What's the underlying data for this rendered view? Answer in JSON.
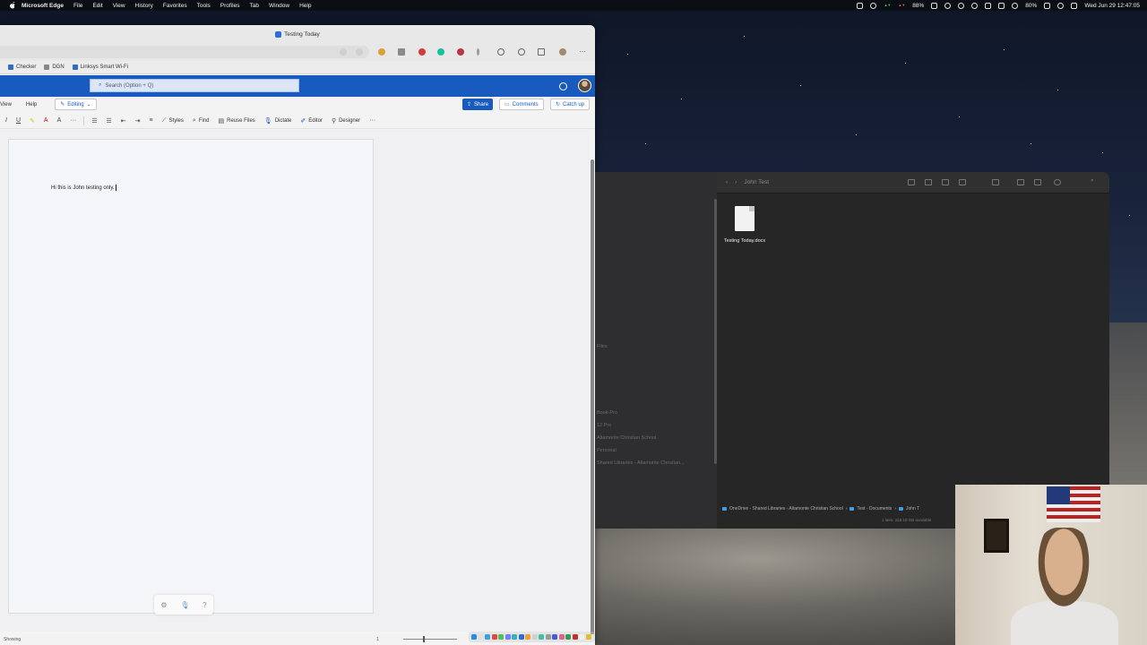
{
  "menubar": {
    "app_name": "Microsoft Edge",
    "items": [
      "File",
      "Edit",
      "View",
      "History",
      "Favorites",
      "Tools",
      "Profiles",
      "Tab",
      "Window",
      "Help"
    ],
    "battery": "88%",
    "wifi_battery": "80%",
    "datetime": "Wed Jun 29 12:47:05"
  },
  "edge": {
    "tab_title": "Testing Today",
    "favorites": [
      "Checker",
      "DGN",
      "Linksys Smart Wi-Fi"
    ]
  },
  "word": {
    "search_placeholder": "Search (Option + Q)",
    "menu_tabs": [
      "View",
      "Help"
    ],
    "editing_label": "Editing",
    "share_label": "Share",
    "comments_label": "Comments",
    "catchup_label": "Catch up",
    "ribbon": {
      "styles": "Styles",
      "find": "Find",
      "reuse_files": "Reuse Files",
      "dictate": "Dictate",
      "editor": "Editor",
      "designer": "Designer"
    },
    "document_text": "Hi this is John testing only.",
    "status_text": "Showing",
    "page_number": "1"
  },
  "finder": {
    "title": "John Test",
    "file_name": "Testing Today.docx",
    "sidebar_items": [
      "Files",
      "Book-Pro",
      "12 Pro",
      "Altamonte Christian School",
      "Personal",
      "Shared Libraries - Altamonte Christian..."
    ],
    "path": [
      "OneDrive - Shared Libraries - Altamonte Christian School",
      "Test - Documents",
      "John T"
    ],
    "status": "1 item, 218.19 GB available"
  },
  "colors": {
    "word_blue": "#185abd",
    "menubar_bg": "#0b0e14",
    "finder_bg": "#262626"
  }
}
